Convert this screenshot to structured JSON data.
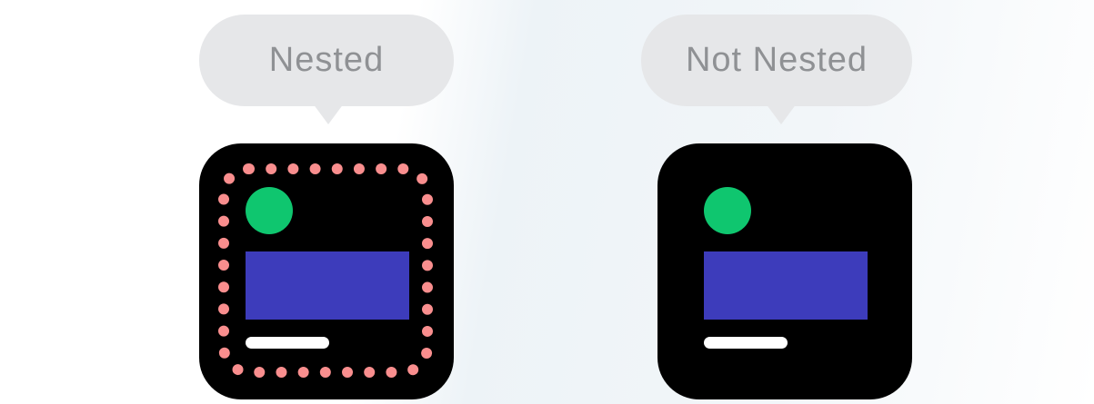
{
  "panels": [
    {
      "label": "Nested",
      "shows_container_outline": true
    },
    {
      "label": "Not Nested",
      "shows_container_outline": false
    }
  ],
  "colors": {
    "bubble": "#e6e7e9",
    "bubble_text": "#8f9194",
    "card": "#000000",
    "circle": "#0fc66f",
    "rect": "#3d3cbb",
    "bar": "#ffffff",
    "container_outline": "#f98e8e"
  }
}
